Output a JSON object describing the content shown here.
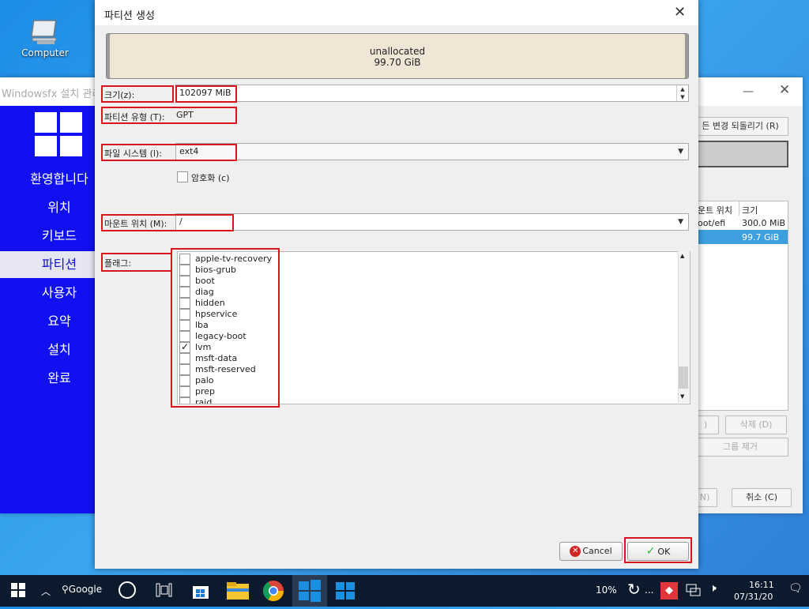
{
  "desktop": {
    "icon_label": "Computer"
  },
  "bg_window": {
    "title": "Windowsfx 설치 관리",
    "nav": [
      "환영합니다",
      "위치",
      "키보드",
      "파티션",
      "사용자",
      "요약",
      "설치",
      "완료"
    ],
    "active_nav": "파티션",
    "revert_button": "든 변경 되돌리기 (R)",
    "table_headers": [
      "운트 위치",
      "크기"
    ],
    "rows": [
      {
        "mount": "oot/efi",
        "size": "300.0 MiB"
      },
      {
        "mount": "",
        "size": "99.7 GiB"
      }
    ],
    "delete_button": "삭제 (D)",
    "group_remove_button": "그룹 제거",
    "next_fragment": "N)",
    "cancel_button": "취소 (C)",
    "edit_fragment": ")"
  },
  "dialog": {
    "title": "파티션 생성",
    "partition_bar": {
      "label": "unallocated",
      "size": "99.70 GiB"
    },
    "size_label": "크기(z):",
    "size_value": "102097 MiB",
    "type_label": "파티션 유형 (T):",
    "type_value": "GPT",
    "fs_label": "파일 시스템 (l):",
    "fs_value": "ext4",
    "encrypt_label": "암호화 (c)",
    "mount_label": "마운트 위치 (M):",
    "mount_value": "/",
    "flags_label": "플래그:",
    "flags": [
      {
        "name": "apple-tv-recovery",
        "checked": false
      },
      {
        "name": "bios-grub",
        "checked": false
      },
      {
        "name": "boot",
        "checked": false
      },
      {
        "name": "diag",
        "checked": false
      },
      {
        "name": "hidden",
        "checked": false
      },
      {
        "name": "hpservice",
        "checked": false
      },
      {
        "name": "lba",
        "checked": false
      },
      {
        "name": "legacy-boot",
        "checked": false
      },
      {
        "name": "lvm",
        "checked": true
      },
      {
        "name": "msft-data",
        "checked": false
      },
      {
        "name": "msft-reserved",
        "checked": false
      },
      {
        "name": "palo",
        "checked": false
      },
      {
        "name": "prep",
        "checked": false
      },
      {
        "name": "raid",
        "checked": false
      }
    ],
    "cancel_label": "Cancel",
    "ok_label": "OK"
  },
  "taskbar": {
    "search_text": "Google",
    "battery": "10%",
    "time": "16:11",
    "date": "07/31/20",
    "refresh_ellipsis": "..."
  },
  "colors": {
    "accent_blue": "#1010f0",
    "highlight": "#3d9ee0",
    "red_outline": "#d8151d"
  }
}
